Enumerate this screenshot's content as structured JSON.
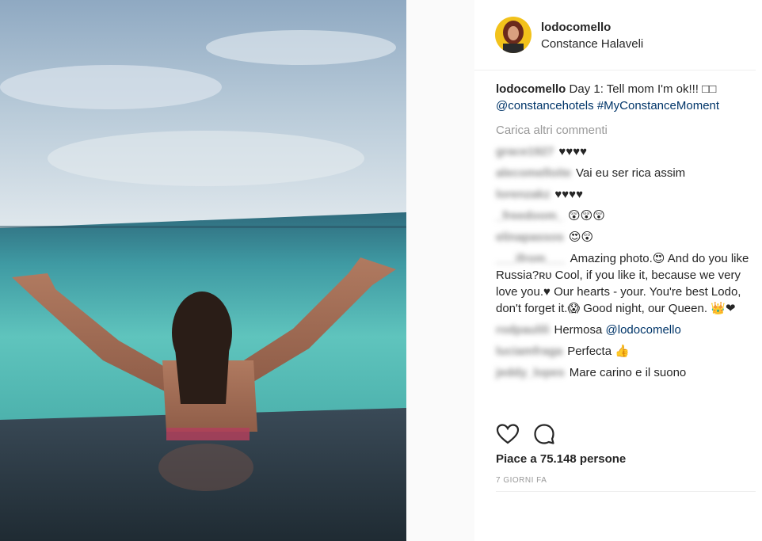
{
  "post": {
    "username": "lodocomello",
    "location": "Constance Halaveli",
    "caption": {
      "username": "lodocomello",
      "text": "Day 1: Tell mom I'm ok!!! □□",
      "mention": "@constancehotels",
      "hashtag": "#MyConstanceMoment"
    },
    "load_more": "Carica altri commenti",
    "comments": [
      {
        "user": "grace1927",
        "text": "♥♥♥♥"
      },
      {
        "user": "alecomelloite",
        "text": "Vai eu ser rica assim"
      },
      {
        "user": "lorenzakz",
        "text": "♥♥♥♥"
      },
      {
        "user": "_freedoom_",
        "text": "😲😲😲"
      },
      {
        "user": "elinapassos",
        "text": "😍😲"
      },
      {
        "user": "___ifrom___",
        "text": "Amazing photo.😍 And do you like Russia?ʀᴜ Cool, if you like it, because we very love you.♥ Our hearts - your. You're best Lodo, don't forget it.😱 Good night, our Queen. 👑❤"
      },
      {
        "user": "rodpaulili",
        "text": "Hermosa ",
        "mention": "@lodocomello"
      },
      {
        "user": "luciamfraga",
        "text": "Perfecta 👍"
      },
      {
        "user": "jeddy_lopes",
        "text": "Mare carino e il suono"
      }
    ],
    "likes": "Piace a 75.148 persone",
    "time": "7 GIORNI FA"
  },
  "icons": {
    "like": "heart-outline-icon",
    "comment": "speech-bubble-icon"
  },
  "colors": {
    "link": "#003569",
    "muted": "#999999",
    "text": "#262626"
  }
}
